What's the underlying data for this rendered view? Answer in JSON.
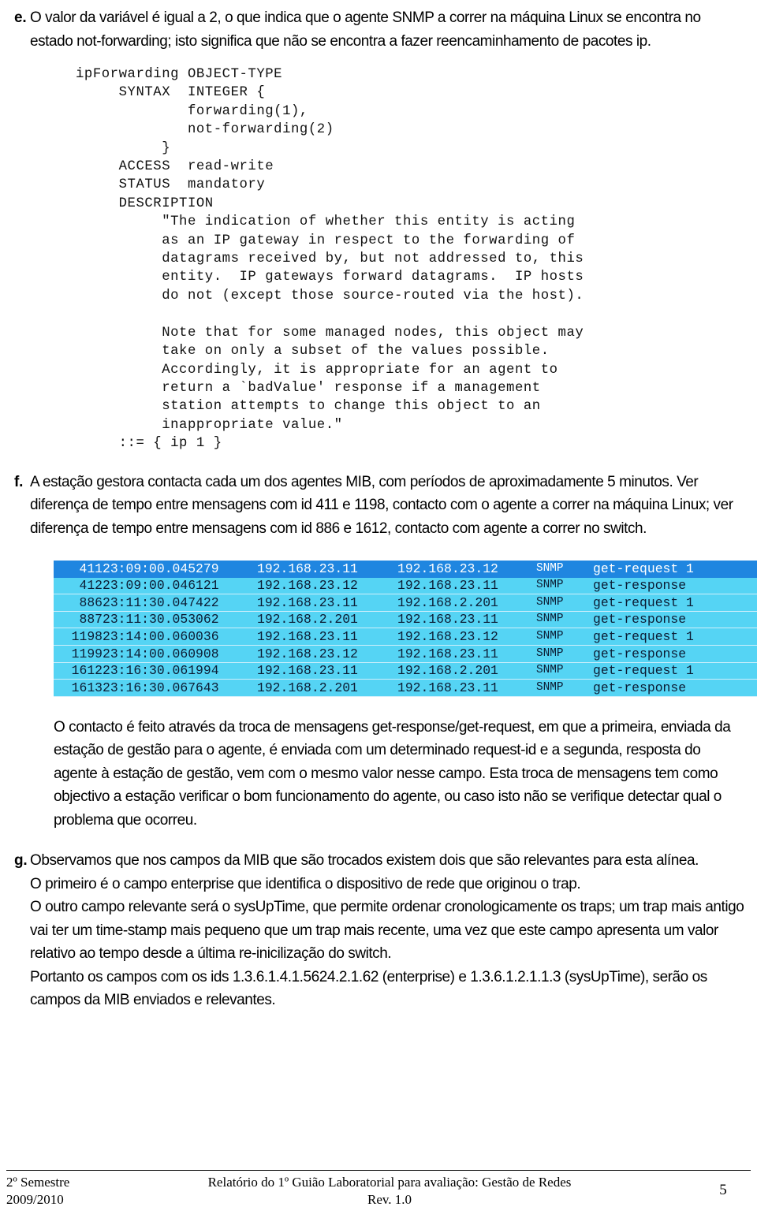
{
  "items": {
    "e": {
      "marker": "e.",
      "text": "O valor da variável é igual a 2, o que indica que o agente SNMP a correr na máquina Linux se encontra no estado not-forwarding; isto significa que não se encontra a fazer reencaminhamento de pacotes ip."
    },
    "f": {
      "marker": "f.",
      "text": "A estação gestora contacta cada um dos agentes MIB, com períodos de aproximadamente 5 minutos. Ver diferença de tempo entre mensagens com id 411 e 1198, contacto com o agente a correr na máquina Linux; ver diferença de tempo entre mensagens com id 886 e 1612, contacto com agente a correr no switch."
    },
    "g": {
      "marker": "g.",
      "para1": "Observamos que nos campos da MIB que são trocados existem dois que são relevantes para esta alínea.",
      "para2": "O primeiro é o campo enterprise que identifica o dispositivo de rede que originou o trap.",
      "para3": "O outro campo relevante será o sysUpTime, que permite ordenar cronologicamente os traps; um trap mais antigo vai ter um time-stamp mais pequeno que um trap mais recente, uma vez que este campo apresenta um valor relativo ao tempo desde a última re-inicilização do switch.",
      "para4": "Portanto os campos com os ids 1.3.6.1.4.1.5624.2.1.62 (enterprise) e 1.3.6.1.2.1.1.3 (sysUpTime), serão os campos da MIB enviados e relevantes."
    }
  },
  "code_block": {
    "language": "SNMP MIB OBJECT-TYPE definition",
    "text": "ipForwarding OBJECT-TYPE\n     SYNTAX  INTEGER {\n             forwarding(1),\n             not-forwarding(2)\n          }\n     ACCESS  read-write\n     STATUS  mandatory\n     DESCRIPTION\n          \"The indication of whether this entity is acting\n          as an IP gateway in respect to the forwarding of\n          datagrams received by, but not addressed to, this\n          entity.  IP gateways forward datagrams.  IP hosts\n          do not (except those source-routed via the host).\n\n          Note that for some managed nodes, this object may\n          take on only a subset of the values possible.\n          Accordingly, it is appropriate for an agent to\n          return a `badValue' response if a management\n          station attempts to change this object to an\n          inappropriate value.\"\n     ::= { ip 1 }"
  },
  "capture": {
    "selected_row_index": 0,
    "colors": {
      "row_background": "#55d4f4",
      "selected_background": "#1f86e0",
      "row_text": "#0b1b33",
      "selected_text": "#ffffff"
    },
    "rows": [
      {
        "no": "411",
        "time": "23:09:00.045279",
        "src": "192.168.23.11",
        "dst": "192.168.23.12",
        "proto": "SNMP",
        "info": "get-request 1"
      },
      {
        "no": "412",
        "time": "23:09:00.046121",
        "src": "192.168.23.12",
        "dst": "192.168.23.11",
        "proto": "SNMP",
        "info": "get-response"
      },
      {
        "no": "886",
        "time": "23:11:30.047422",
        "src": "192.168.23.11",
        "dst": "192.168.2.201",
        "proto": "SNMP",
        "info": "get-request 1"
      },
      {
        "no": "887",
        "time": "23:11:30.053062",
        "src": "192.168.2.201",
        "dst": "192.168.23.11",
        "proto": "SNMP",
        "info": "get-response"
      },
      {
        "no": "1198",
        "time": "23:14:00.060036",
        "src": "192.168.23.11",
        "dst": "192.168.23.12",
        "proto": "SNMP",
        "info": "get-request 1"
      },
      {
        "no": "1199",
        "time": "23:14:00.060908",
        "src": "192.168.23.12",
        "dst": "192.168.23.11",
        "proto": "SNMP",
        "info": "get-response"
      },
      {
        "no": "1612",
        "time": "23:16:30.061994",
        "src": "192.168.23.11",
        "dst": "192.168.2.201",
        "proto": "SNMP",
        "info": "get-request 1"
      },
      {
        "no": "1613",
        "time": "23:16:30.067643",
        "src": "192.168.2.201",
        "dst": "192.168.23.11",
        "proto": "SNMP",
        "info": "get-response"
      }
    ]
  },
  "body_paragraph": "O contacto é feito através da troca de mensagens get-response/get-request, em que a primeira, enviada da estação de gestão para o agente, é enviada com um determinado request-id e a segunda, resposta do agente à estação de gestão, vem com o mesmo valor nesse campo. Esta troca de mensagens tem como objectivo a estação verificar o bom funcionamento do agente, ou caso isto não se verifique detectar qual o problema que ocorreu.",
  "footer": {
    "semester": "2º Semestre",
    "year": "2009/2010",
    "title": "Relatório do 1º Guião Laboratorial para avaliação: Gestão de Redes",
    "revision": "Rev. 1.0",
    "page_number": "5"
  }
}
